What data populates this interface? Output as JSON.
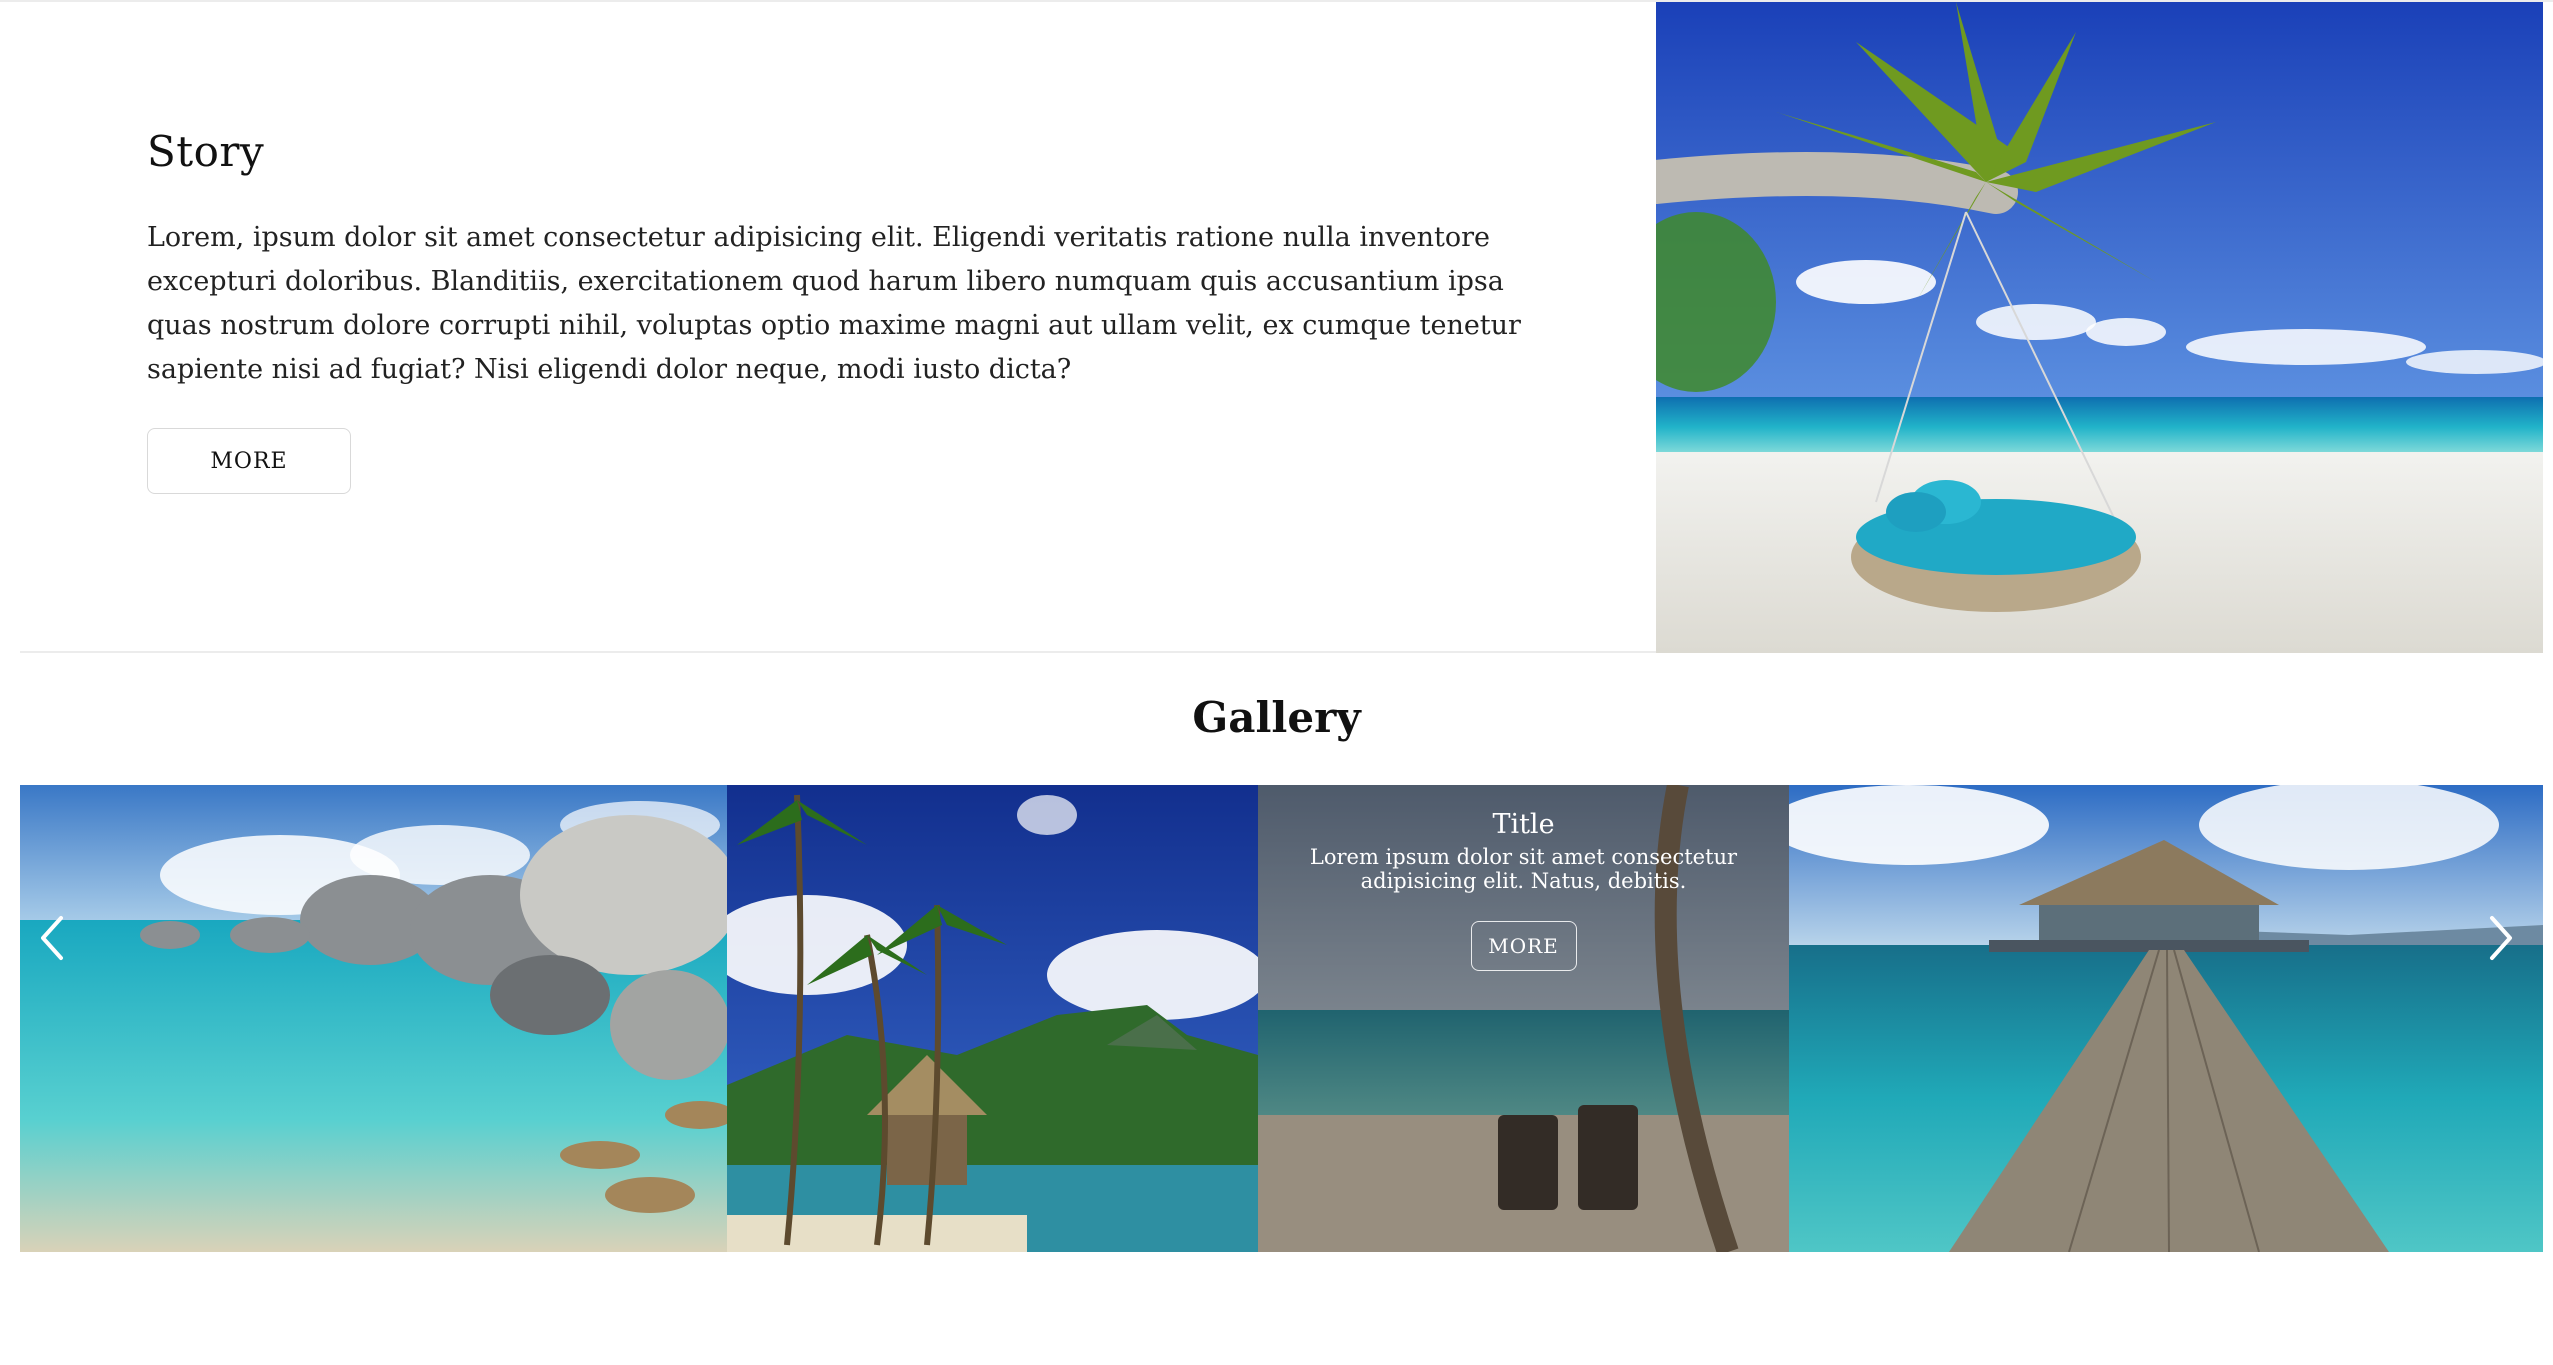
{
  "story": {
    "title": "Story",
    "body": "Lorem, ipsum dolor sit amet consectetur adipisicing elit. Eligendi veritatis ratione nulla inventore excepturi doloribus. Blanditiis, exercitationem quod harum libero numquam quis accusantium ipsa quas nostrum dolore corrupti nihil, voluptas optio maxime magni aut ullam velit, ex cumque tenetur sapiente nisi ad fugiat? Nisi eligendi dolor neque, modi iusto dicta?",
    "more_label": "MORE",
    "image": "beach-hammock-palm-photo"
  },
  "gallery": {
    "title": "Gallery",
    "slides": [
      {
        "image": "rocky-beach-photo"
      },
      {
        "image": "palm-hut-mountain-photo"
      },
      {
        "image": "beach-chairs-palm-photo",
        "caption_title": "Title",
        "caption_text": "Lorem ipsum dolor sit amet consectetur adipisicing elit. Natus, debitis.",
        "more_label": "MORE"
      },
      {
        "image": "pier-hut-photo"
      }
    ],
    "prev_icon": "chevron-left-icon",
    "next_icon": "chevron-right-icon"
  },
  "colors": {
    "background": "#ffffff",
    "divider": "#ececec",
    "text": "#111111"
  }
}
